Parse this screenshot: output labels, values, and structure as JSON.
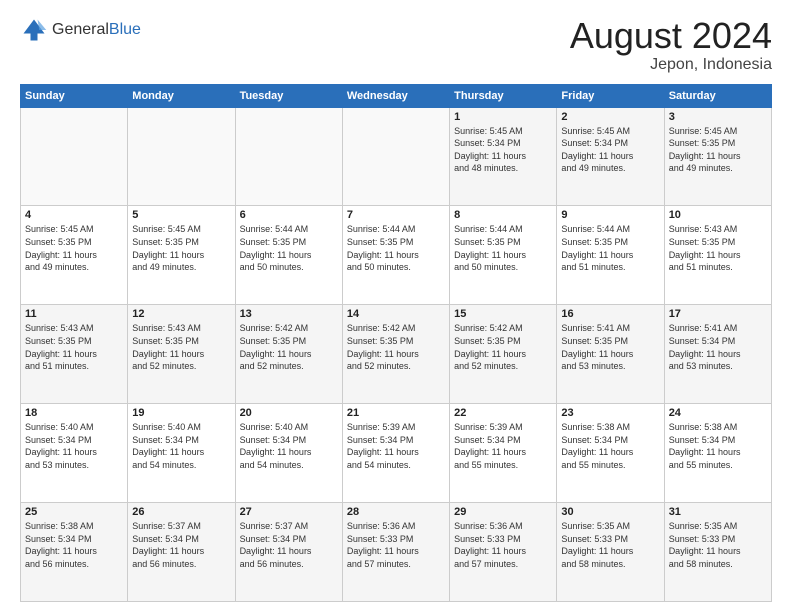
{
  "logo": {
    "general": "General",
    "blue": "Blue"
  },
  "header": {
    "title": "August 2024",
    "subtitle": "Jepon, Indonesia"
  },
  "days_of_week": [
    "Sunday",
    "Monday",
    "Tuesday",
    "Wednesday",
    "Thursday",
    "Friday",
    "Saturday"
  ],
  "weeks": [
    [
      {
        "day": "",
        "info": ""
      },
      {
        "day": "",
        "info": ""
      },
      {
        "day": "",
        "info": ""
      },
      {
        "day": "",
        "info": ""
      },
      {
        "day": "1",
        "info": "Sunrise: 5:45 AM\nSunset: 5:34 PM\nDaylight: 11 hours\nand 48 minutes."
      },
      {
        "day": "2",
        "info": "Sunrise: 5:45 AM\nSunset: 5:34 PM\nDaylight: 11 hours\nand 49 minutes."
      },
      {
        "day": "3",
        "info": "Sunrise: 5:45 AM\nSunset: 5:35 PM\nDaylight: 11 hours\nand 49 minutes."
      }
    ],
    [
      {
        "day": "4",
        "info": "Sunrise: 5:45 AM\nSunset: 5:35 PM\nDaylight: 11 hours\nand 49 minutes."
      },
      {
        "day": "5",
        "info": "Sunrise: 5:45 AM\nSunset: 5:35 PM\nDaylight: 11 hours\nand 49 minutes."
      },
      {
        "day": "6",
        "info": "Sunrise: 5:44 AM\nSunset: 5:35 PM\nDaylight: 11 hours\nand 50 minutes."
      },
      {
        "day": "7",
        "info": "Sunrise: 5:44 AM\nSunset: 5:35 PM\nDaylight: 11 hours\nand 50 minutes."
      },
      {
        "day": "8",
        "info": "Sunrise: 5:44 AM\nSunset: 5:35 PM\nDaylight: 11 hours\nand 50 minutes."
      },
      {
        "day": "9",
        "info": "Sunrise: 5:44 AM\nSunset: 5:35 PM\nDaylight: 11 hours\nand 51 minutes."
      },
      {
        "day": "10",
        "info": "Sunrise: 5:43 AM\nSunset: 5:35 PM\nDaylight: 11 hours\nand 51 minutes."
      }
    ],
    [
      {
        "day": "11",
        "info": "Sunrise: 5:43 AM\nSunset: 5:35 PM\nDaylight: 11 hours\nand 51 minutes."
      },
      {
        "day": "12",
        "info": "Sunrise: 5:43 AM\nSunset: 5:35 PM\nDaylight: 11 hours\nand 52 minutes."
      },
      {
        "day": "13",
        "info": "Sunrise: 5:42 AM\nSunset: 5:35 PM\nDaylight: 11 hours\nand 52 minutes."
      },
      {
        "day": "14",
        "info": "Sunrise: 5:42 AM\nSunset: 5:35 PM\nDaylight: 11 hours\nand 52 minutes."
      },
      {
        "day": "15",
        "info": "Sunrise: 5:42 AM\nSunset: 5:35 PM\nDaylight: 11 hours\nand 52 minutes."
      },
      {
        "day": "16",
        "info": "Sunrise: 5:41 AM\nSunset: 5:35 PM\nDaylight: 11 hours\nand 53 minutes."
      },
      {
        "day": "17",
        "info": "Sunrise: 5:41 AM\nSunset: 5:34 PM\nDaylight: 11 hours\nand 53 minutes."
      }
    ],
    [
      {
        "day": "18",
        "info": "Sunrise: 5:40 AM\nSunset: 5:34 PM\nDaylight: 11 hours\nand 53 minutes."
      },
      {
        "day": "19",
        "info": "Sunrise: 5:40 AM\nSunset: 5:34 PM\nDaylight: 11 hours\nand 54 minutes."
      },
      {
        "day": "20",
        "info": "Sunrise: 5:40 AM\nSunset: 5:34 PM\nDaylight: 11 hours\nand 54 minutes."
      },
      {
        "day": "21",
        "info": "Sunrise: 5:39 AM\nSunset: 5:34 PM\nDaylight: 11 hours\nand 54 minutes."
      },
      {
        "day": "22",
        "info": "Sunrise: 5:39 AM\nSunset: 5:34 PM\nDaylight: 11 hours\nand 55 minutes."
      },
      {
        "day": "23",
        "info": "Sunrise: 5:38 AM\nSunset: 5:34 PM\nDaylight: 11 hours\nand 55 minutes."
      },
      {
        "day": "24",
        "info": "Sunrise: 5:38 AM\nSunset: 5:34 PM\nDaylight: 11 hours\nand 55 minutes."
      }
    ],
    [
      {
        "day": "25",
        "info": "Sunrise: 5:38 AM\nSunset: 5:34 PM\nDaylight: 11 hours\nand 56 minutes."
      },
      {
        "day": "26",
        "info": "Sunrise: 5:37 AM\nSunset: 5:34 PM\nDaylight: 11 hours\nand 56 minutes."
      },
      {
        "day": "27",
        "info": "Sunrise: 5:37 AM\nSunset: 5:34 PM\nDaylight: 11 hours\nand 56 minutes."
      },
      {
        "day": "28",
        "info": "Sunrise: 5:36 AM\nSunset: 5:33 PM\nDaylight: 11 hours\nand 57 minutes."
      },
      {
        "day": "29",
        "info": "Sunrise: 5:36 AM\nSunset: 5:33 PM\nDaylight: 11 hours\nand 57 minutes."
      },
      {
        "day": "30",
        "info": "Sunrise: 5:35 AM\nSunset: 5:33 PM\nDaylight: 11 hours\nand 58 minutes."
      },
      {
        "day": "31",
        "info": "Sunrise: 5:35 AM\nSunset: 5:33 PM\nDaylight: 11 hours\nand 58 minutes."
      }
    ]
  ]
}
